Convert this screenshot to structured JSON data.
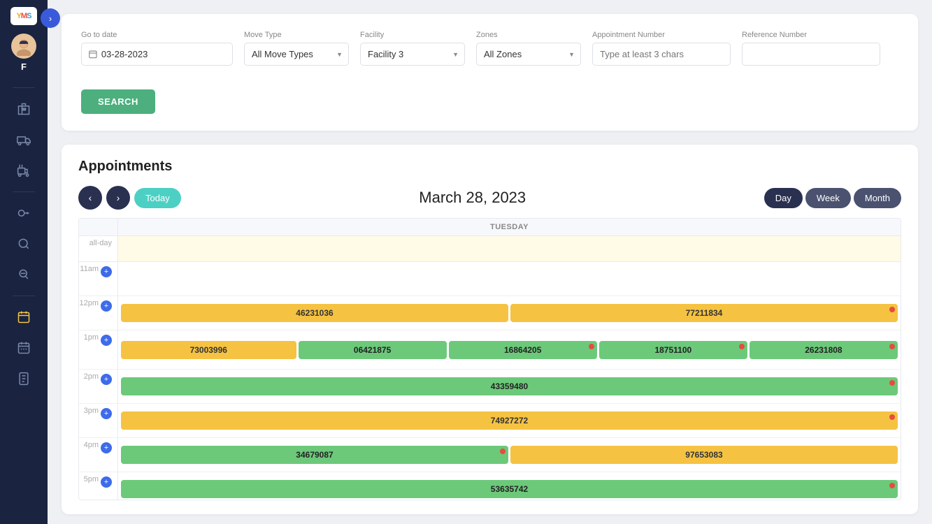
{
  "app": {
    "logo": "YMS",
    "user_letter": "F",
    "power_label": "⏻"
  },
  "sidebar": {
    "icons": [
      {
        "name": "building-icon",
        "symbol": "🏛",
        "active": false
      },
      {
        "name": "truck-icon",
        "symbol": "🚚",
        "active": false
      },
      {
        "name": "forklift-icon",
        "symbol": "🚛",
        "active": false
      },
      {
        "name": "key-icon",
        "symbol": "🔑",
        "active": false
      },
      {
        "name": "search-icon",
        "symbol": "🔍",
        "active": false
      },
      {
        "name": "search2-icon",
        "symbol": "🔎",
        "active": false
      },
      {
        "name": "calendar-icon",
        "symbol": "📅",
        "active": true
      },
      {
        "name": "calendar2-icon",
        "symbol": "📆",
        "active": false
      },
      {
        "name": "document-icon",
        "symbol": "📋",
        "active": false
      }
    ]
  },
  "search": {
    "goto_date_label": "Go to date",
    "goto_date_value": "03-28-2023",
    "move_type_label": "Move Type",
    "move_type_value": "All Move Types",
    "facility_label": "Facility",
    "facility_value": "Facility 3",
    "zones_label": "Zones",
    "zones_value": "All Zones",
    "appt_number_label": "Appointment Number",
    "appt_number_placeholder": "Type at least 3 chars",
    "ref_number_label": "Reference Number",
    "ref_number_placeholder": "",
    "search_button": "SEARCH"
  },
  "appointments": {
    "title": "Appointments",
    "current_date": "March 28, 2023",
    "day_of_week": "TUESDAY",
    "view_buttons": [
      "Day",
      "Week",
      "Month"
    ],
    "active_view": "Day",
    "time_slots": [
      {
        "time": "11am",
        "events": []
      },
      {
        "time": "12pm",
        "events": [
          {
            "id": "46231036",
            "type": "orange",
            "dot": false,
            "flex": 1
          },
          {
            "id": "77211834",
            "type": "orange",
            "dot": true,
            "flex": 1
          }
        ]
      },
      {
        "time": "1pm",
        "events": [
          {
            "id": "73003996",
            "type": "orange",
            "dot": false,
            "flex": 0.5
          },
          {
            "id": "06421875",
            "type": "green",
            "dot": false,
            "flex": 0.5
          },
          {
            "id": "16864205",
            "type": "green",
            "dot": true,
            "flex": 0.5
          },
          {
            "id": "18751100",
            "type": "green",
            "dot": true,
            "flex": 0.5
          },
          {
            "id": "26231808",
            "type": "green",
            "dot": true,
            "flex": 0.5
          }
        ]
      },
      {
        "time": "2pm",
        "events": [
          {
            "id": "43359480",
            "type": "green",
            "dot": true,
            "flex": 1
          }
        ]
      },
      {
        "time": "3pm",
        "events": [
          {
            "id": "74927272",
            "type": "orange",
            "dot": true,
            "flex": 1
          }
        ]
      },
      {
        "time": "4pm",
        "events": [
          {
            "id": "34679087",
            "type": "green",
            "dot": true,
            "flex": 1
          },
          {
            "id": "97653083",
            "type": "orange",
            "dot": false,
            "flex": 1
          }
        ]
      },
      {
        "time": "5pm",
        "events": [
          {
            "id": "53635742",
            "type": "green",
            "dot": true,
            "flex": 1
          }
        ]
      }
    ]
  },
  "colors": {
    "sidebar_bg": "#1a2340",
    "accent_blue": "#3a5bd9",
    "accent_teal": "#4dd0c4",
    "event_orange": "#f5c242",
    "event_green": "#6cc97a",
    "dot_red": "#e74c3c",
    "search_btn": "#4caf7d"
  }
}
